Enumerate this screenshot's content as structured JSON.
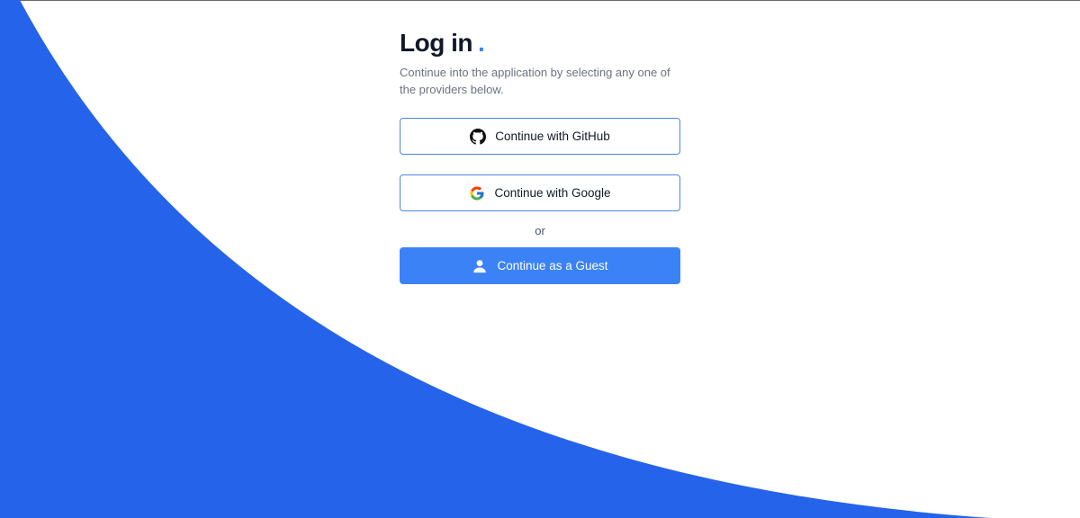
{
  "login": {
    "title": "Log in",
    "title_dot": ".",
    "subtitle": "Continue into the application by selecting any one of the providers below.",
    "github_label": "Continue with GitHub",
    "google_label": "Continue with Google",
    "divider_text": "or",
    "guest_label": "Continue as a Guest"
  },
  "icons": {
    "github": "github-icon",
    "google": "google-icon",
    "guest": "user-icon"
  },
  "colors": {
    "background_shape": "#2563eb",
    "accent": "#3b82f6",
    "button_border": "#4a86e0",
    "title_text": "#111827",
    "subtitle_text": "#6b7280"
  }
}
